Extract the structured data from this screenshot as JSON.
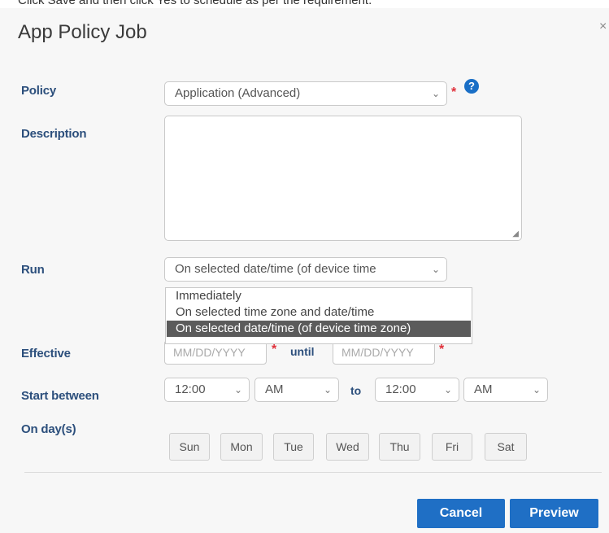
{
  "instruction": "Click Save and then click Yes to schedule as per the requirement.",
  "dialog": {
    "title": "App Policy Job",
    "close_glyph": "×"
  },
  "form": {
    "policy_label": "Policy",
    "policy_value": "Application (Advanced)",
    "required_marker": "*",
    "help_glyph": "?",
    "description_label": "Description",
    "description_value": "",
    "run_label": "Run",
    "run_value": "On selected date/time (of device time",
    "run_options": [
      "Immediately",
      "On selected time zone and date/time",
      "On selected date/time (of device time zone)"
    ],
    "run_selected_index": 2,
    "effective_label": "Effective",
    "effective_from_placeholder": "MM/DD/YYYY",
    "until_label": "until",
    "effective_until_placeholder": "MM/DD/YYYY",
    "start_between_label": "Start between",
    "start_time": "12:00",
    "start_ampm": "AM",
    "to_label": "to",
    "end_time": "12:00",
    "end_ampm": "AM",
    "days_label": "On day(s)",
    "days": [
      "Sun",
      "Mon",
      "Tue",
      "Wed",
      "Thu",
      "Fri",
      "Sat"
    ]
  },
  "footer": {
    "cancel_label": "Cancel",
    "preview_label": "Preview"
  },
  "icons": {
    "chevron": "⌄",
    "resize": "◢"
  },
  "colors": {
    "label_blue": "#2c4f7c",
    "button_blue": "#1f6fc5",
    "required_red": "#e0303a"
  }
}
